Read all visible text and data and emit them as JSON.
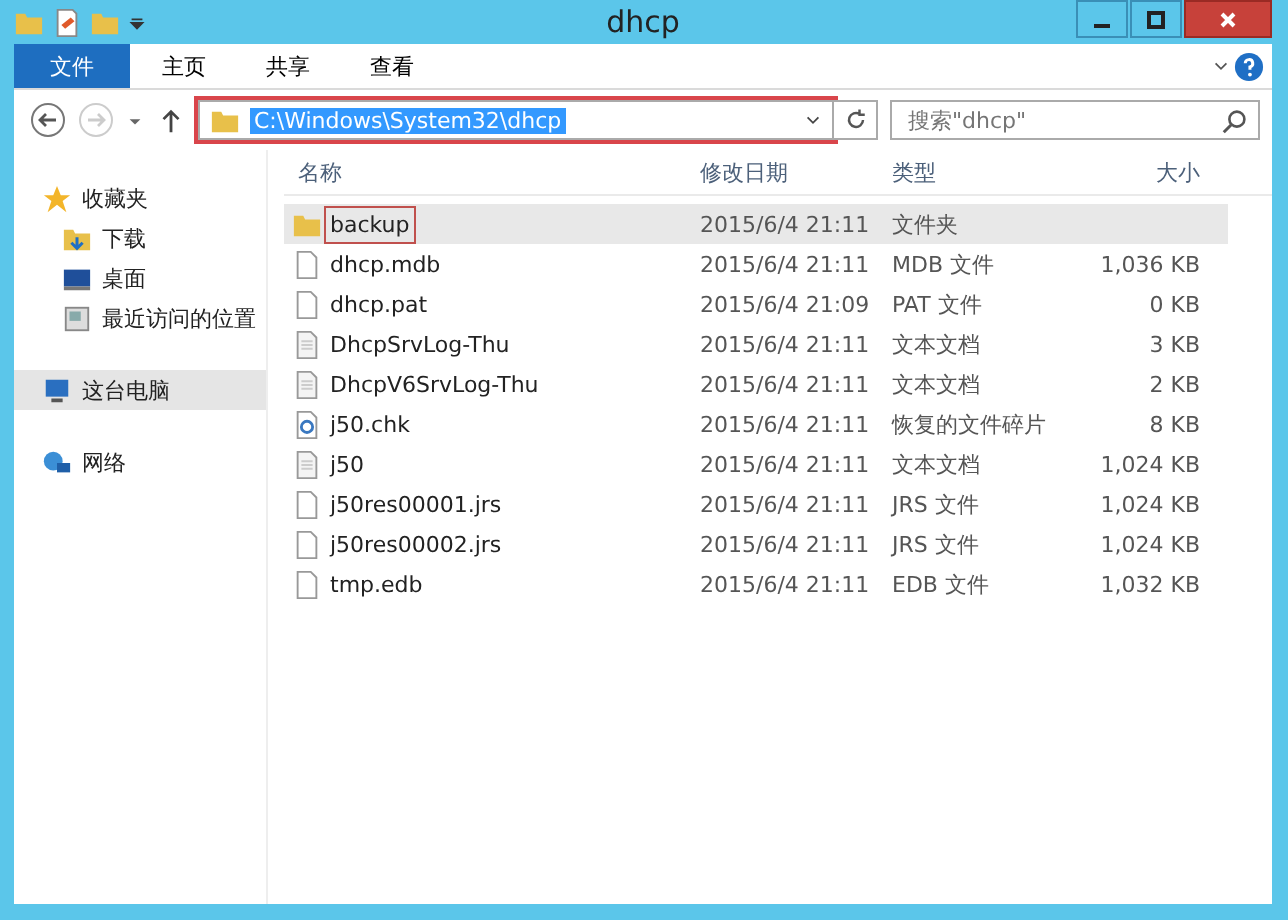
{
  "window": {
    "title": "dhcp"
  },
  "ribbon_tabs": [
    {
      "label": "文件",
      "selected": true
    },
    {
      "label": "主页",
      "selected": false
    },
    {
      "label": "共享",
      "selected": false
    },
    {
      "label": "查看",
      "selected": false
    }
  ],
  "address": {
    "path": "C:\\Windows\\System32\\dhcp",
    "text_selected": true,
    "marked": true
  },
  "search": {
    "placeholder": "搜索\"dhcp\""
  },
  "sidebar": {
    "items": [
      {
        "label": "收藏夹",
        "kind": "star",
        "selected": false,
        "children": [
          {
            "label": "下载",
            "kind": "download",
            "selected": false
          },
          {
            "label": "桌面",
            "kind": "desktop",
            "selected": false
          },
          {
            "label": "最近访问的位置",
            "kind": "recent",
            "selected": false
          }
        ]
      },
      {
        "label": "这台电脑",
        "kind": "computer",
        "selected": true
      },
      {
        "label": "网络",
        "kind": "network",
        "selected": false
      }
    ]
  },
  "table": {
    "columns": [
      "名称",
      "修改日期",
      "类型",
      "大小"
    ],
    "rows": [
      {
        "kind": "folder",
        "name": "backup",
        "date": "2015/6/4 21:11",
        "type": "文件夹",
        "selected": true,
        "marked": true
      },
      {
        "kind": "blank",
        "name": "dhcp.mdb",
        "date": "2015/6/4 21:11",
        "type": "MDB 文件",
        "size": "1,036 KB",
        "selected": false,
        "marked": false
      },
      {
        "kind": "blank",
        "name": "dhcp.pat",
        "date": "2015/6/4 21:09",
        "type": "PAT 文件",
        "size": "0 KB",
        "selected": false,
        "marked": false
      },
      {
        "kind": "text",
        "name": "DhcpSrvLog-Thu",
        "date": "2015/6/4 21:11",
        "type": "文本文档",
        "size": "3 KB",
        "selected": false,
        "marked": false
      },
      {
        "kind": "text",
        "name": "DhcpV6SrvLog-Thu",
        "date": "2015/6/4 21:11",
        "type": "文本文档",
        "size": "2 KB",
        "selected": false,
        "marked": false
      },
      {
        "kind": "recovered",
        "name": "j50.chk",
        "date": "2015/6/4 21:11",
        "type": "恢复的文件碎片",
        "size": "8 KB",
        "selected": false,
        "marked": false
      },
      {
        "kind": "text",
        "name": "j50",
        "date": "2015/6/4 21:11",
        "type": "文本文档",
        "size": "1,024 KB",
        "selected": false,
        "marked": false
      },
      {
        "kind": "blank",
        "name": "j50res00001.jrs",
        "date": "2015/6/4 21:11",
        "type": "JRS 文件",
        "size": "1,024 KB",
        "selected": false,
        "marked": false
      },
      {
        "kind": "blank",
        "name": "j50res00002.jrs",
        "date": "2015/6/4 21:11",
        "type": "JRS 文件",
        "size": "1,024 KB",
        "selected": false,
        "marked": false
      },
      {
        "kind": "blank",
        "name": "tmp.edb",
        "date": "2015/6/4 21:11",
        "type": "EDB 文件",
        "size": "1,032 KB",
        "selected": false,
        "marked": false
      }
    ]
  }
}
